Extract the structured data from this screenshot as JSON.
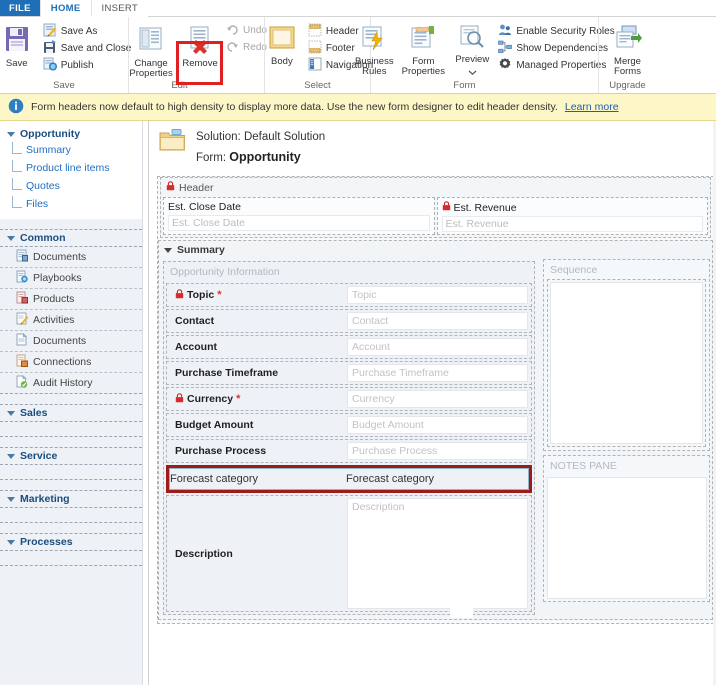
{
  "window": {
    "tabs": [
      {
        "label": "FILE",
        "style": "file"
      },
      {
        "label": "HOME",
        "style": "active"
      },
      {
        "label": "INSERT",
        "style": "inactive"
      }
    ]
  },
  "ribbon": {
    "groups": [
      {
        "name": "Save",
        "label": "Save",
        "big": [
          {
            "label": "Save",
            "icon": "save-disk-icon"
          }
        ],
        "small": [
          {
            "label": "Save As",
            "icon": "save-as-icon"
          },
          {
            "label": "Save and Close",
            "icon": "save-and-close-icon"
          },
          {
            "label": "Publish",
            "icon": "publish-icon"
          }
        ]
      },
      {
        "name": "Edit",
        "label": "Edit",
        "big": [
          {
            "label": "Change Properties",
            "icon": "change-properties-icon"
          },
          {
            "label": "Remove",
            "icon": "remove-icon"
          }
        ],
        "small": [
          {
            "label": "Undo",
            "icon": "undo-icon",
            "disabled": true
          },
          {
            "label": "Redo",
            "icon": "redo-icon",
            "disabled": true
          }
        ]
      },
      {
        "name": "Select",
        "label": "Select",
        "big": [
          {
            "label": "Body",
            "icon": "body-icon"
          }
        ],
        "small": [
          {
            "label": "Header",
            "icon": "header-icon"
          },
          {
            "label": "Footer",
            "icon": "footer-icon"
          },
          {
            "label": "Navigation",
            "icon": "navigation-icon"
          }
        ]
      },
      {
        "name": "Form",
        "label": "Form",
        "big": [
          {
            "label": "Business Rules",
            "icon": "business-rules-icon"
          },
          {
            "label": "Form Properties",
            "icon": "form-properties-icon"
          },
          {
            "label": "Preview",
            "icon": "preview-icon",
            "dropdown": true
          }
        ],
        "small": [
          {
            "label": "Enable Security Roles",
            "icon": "security-roles-icon"
          },
          {
            "label": "Show Dependencies",
            "icon": "show-dependencies-icon"
          },
          {
            "label": "Managed Properties",
            "icon": "managed-properties-icon"
          }
        ]
      },
      {
        "name": "Upgrade",
        "label": "Upgrade",
        "big": [
          {
            "label": "Merge Forms",
            "icon": "merge-forms-icon"
          }
        ],
        "small": []
      }
    ],
    "highlight": "Remove"
  },
  "notification": {
    "icon": "info-icon",
    "message": "Form headers now default to high density to display more data. Use the new form designer to edit header density.",
    "link": "Learn more"
  },
  "sidebar": {
    "tree": {
      "root": "Opportunity",
      "children": [
        "Summary",
        "Product line items",
        "Quotes",
        "Files"
      ]
    },
    "groups": [
      {
        "label": "Common",
        "items": [
          {
            "label": "Documents",
            "icon": "documents-icon"
          },
          {
            "label": "Playbooks",
            "icon": "playbooks-icon"
          },
          {
            "label": "Products",
            "icon": "products-icon"
          },
          {
            "label": "Activities",
            "icon": "activities-icon"
          },
          {
            "label": "Documents",
            "icon": "documents-icon"
          },
          {
            "label": "Connections",
            "icon": "connections-icon"
          },
          {
            "label": "Audit History",
            "icon": "audit-history-icon"
          }
        ]
      },
      {
        "label": "Sales",
        "items": []
      },
      {
        "label": "Service",
        "items": []
      },
      {
        "label": "Marketing",
        "items": []
      },
      {
        "label": "Processes",
        "items": []
      }
    ]
  },
  "form": {
    "folder_icon": "folder-icon",
    "solution_line": "Solution: Default Solution",
    "form_prefix": "Form: ",
    "form_name": "Opportunity",
    "header_section": {
      "label": "Header",
      "locked": true,
      "fields": [
        {
          "label": "Est. Close Date",
          "placeholder": "Est. Close Date",
          "locked": false
        },
        {
          "label": "Est. Revenue",
          "placeholder": "Est. Revenue",
          "locked": true
        }
      ]
    },
    "summary_tab": {
      "label": "Summary",
      "group_label": "Opportunity Information",
      "rows": [
        {
          "label": "Topic",
          "placeholder": "Topic",
          "locked": true,
          "required": true
        },
        {
          "label": "Contact",
          "placeholder": "Contact",
          "locked": false,
          "required": false
        },
        {
          "label": "Account",
          "placeholder": "Account",
          "locked": false,
          "required": false
        },
        {
          "label": "Purchase Timeframe",
          "placeholder": "Purchase Timeframe",
          "locked": false,
          "required": false
        },
        {
          "label": "Currency",
          "placeholder": "Currency",
          "locked": true,
          "required": true
        },
        {
          "label": "Budget Amount",
          "placeholder": "Budget Amount",
          "locked": false,
          "required": false
        },
        {
          "label": "Purchase Process",
          "placeholder": "Purchase Process",
          "locked": false,
          "required": false
        }
      ],
      "selected_row": {
        "label": "Forecast category",
        "placeholder": "Forecast category"
      },
      "description_row": {
        "label": "Description",
        "placeholder": "Description"
      }
    },
    "right_column": {
      "sequence_label": "Sequence",
      "notes_label": "NOTES PANE"
    }
  },
  "colors": {
    "file_tab": "#1e6fb8",
    "tab_text": "#1e6fb8",
    "notification_bg": "#fdf7c8",
    "highlight_red": "#e02020",
    "selection_red": "#9e1b1b",
    "required_star": "#d33333",
    "lock_red": "#cc2222"
  }
}
